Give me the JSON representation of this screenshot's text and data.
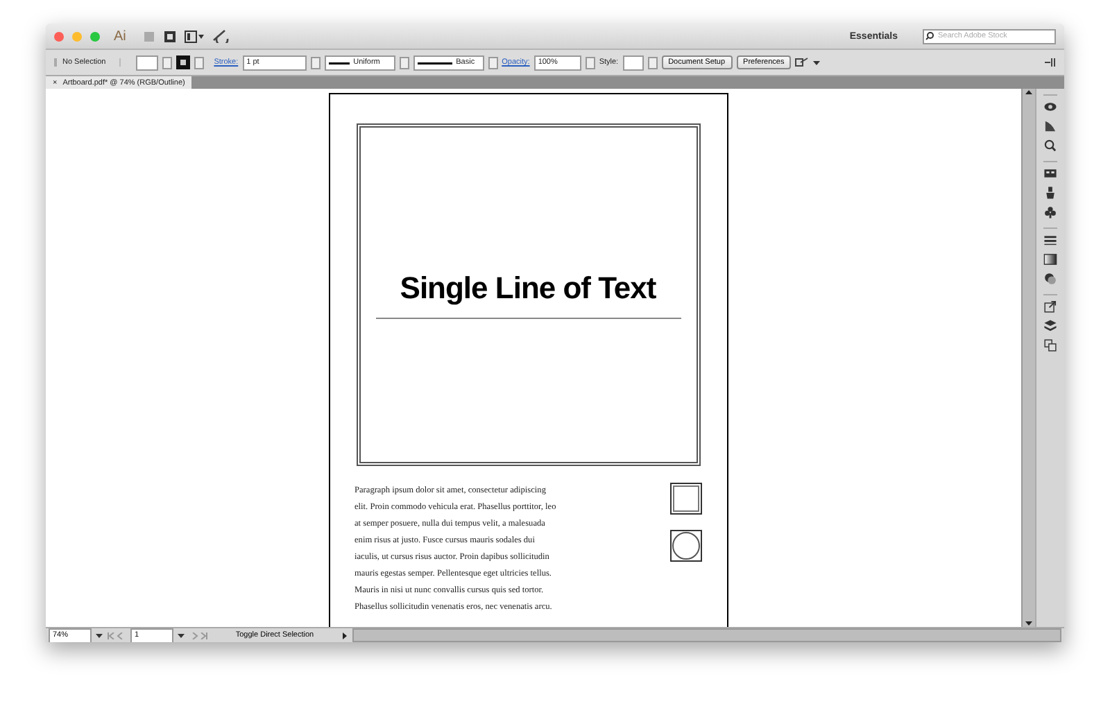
{
  "app": {
    "logo": "Ai",
    "workspace": "Essentials",
    "search": {
      "placeholder": "Search Adobe Stock"
    }
  },
  "control_bar": {
    "selection": "No Selection",
    "stroke_label": "Stroke:",
    "stroke_weight": "1 pt",
    "profile": "Uniform",
    "brush": "Basic",
    "opacity_label": "Opacity:",
    "opacity": "100%",
    "style_label": "Style:",
    "buttons": [
      "Document Setup",
      "Preferences"
    ]
  },
  "tab": {
    "close": "×",
    "title": "Artboard.pdf* @ 74% (RGB/Outline)"
  },
  "artboard": {
    "heading": "Single Line of Text",
    "paragraph": [
      "Paragraph ipsum dolor sit amet, consectetur adipiscing",
      "elit. Proin commodo vehicula erat. Phasellus porttitor, leo",
      "at semper posuere, nulla dui tempus velit, a malesuada",
      "enim risus at justo. Fusce cursus mauris sodales dui",
      "iaculis, ut cursus risus auctor. Proin dapibus sollicitudin",
      "mauris egestas semper. Pellentesque eget ultricies tellus.",
      "Mauris in nisi ut nunc convallis cursus quis sed tortor.",
      "Phasellus sollicitudin venenatis eros, nec venenatis arcu."
    ]
  },
  "status_bar": {
    "zoom": "74%",
    "artboard_number": "1",
    "tool_hint": "Toggle Direct Selection"
  }
}
